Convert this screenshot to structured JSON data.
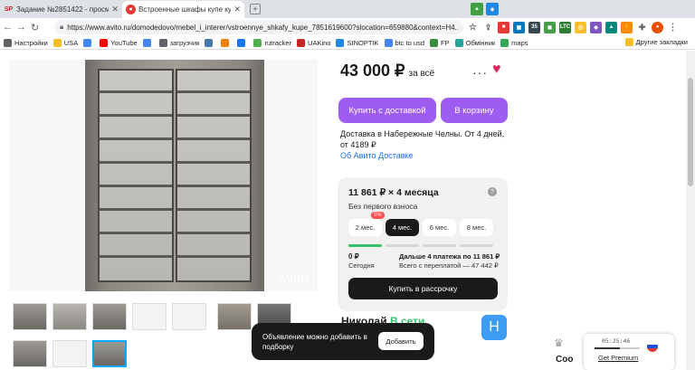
{
  "tabs": [
    {
      "favicon": "SP",
      "title": "Задание №2851422 - просмотр з"
    },
    {
      "favicon": "avito",
      "title": "Встроенные шкафы купе купить"
    }
  ],
  "omnibox": {
    "url": "https://www.avito.ru/domodedovo/mebel_i_interer/vstroennye_shkafy_kupe_7851619600?slocation=659880&context=H4..."
  },
  "bookmarks": [
    {
      "icon": "gear-icon",
      "label": "Настройки",
      "color": "#5f6368"
    },
    {
      "icon": "folder-icon",
      "label": "USA",
      "color": "#f6bf26"
    },
    {
      "icon": "google-icon",
      "label": "",
      "color": "#4285f4"
    },
    {
      "icon": "youtube-icon",
      "label": "YouTube",
      "color": "#ff0000"
    },
    {
      "icon": "g-icon",
      "label": "",
      "color": "#4285f4"
    },
    {
      "icon": "download-icon",
      "label": "загрузчик",
      "color": "#5f6368"
    },
    {
      "icon": "vk-icon",
      "label": "",
      "color": "#4a76a8"
    },
    {
      "icon": "ok-icon",
      "label": "",
      "color": "#ee8208"
    },
    {
      "icon": "f-icon",
      "label": "",
      "color": "#1877f2"
    },
    {
      "icon": "rutracker-icon",
      "label": "rutracker",
      "color": "#4caf50"
    },
    {
      "icon": "uakino-icon",
      "label": "UAKino",
      "color": "#c62828"
    },
    {
      "icon": "sinoptik-icon",
      "label": "SINOPTIK",
      "color": "#1e88e5"
    },
    {
      "icon": "google-icon",
      "label": "btc to usd",
      "color": "#4285f4"
    },
    {
      "icon": "fp-icon",
      "label": "FP",
      "color": "#388e3c"
    },
    {
      "icon": "exchange-icon",
      "label": "Обмінник",
      "color": "#26a69a"
    },
    {
      "icon": "maps-icon",
      "label": "maps",
      "color": "#34a853"
    }
  ],
  "bookmarks_right": "Другие закладки",
  "listing": {
    "price": "43 000 ₽",
    "price_suffix": "за всё",
    "more": "···",
    "buy_delivery": "Купить с доставкой",
    "add_to_cart": "В корзину",
    "delivery_text": "Доставка в Набережные Челны. От 4 дней, от 4189 ₽",
    "delivery_link": "Об Авито Доставке",
    "watermark": "Avito"
  },
  "installment": {
    "title": "11 861 ₽ × 4 месяца",
    "subtitle": "Без первого взноса",
    "help": "?",
    "badge": "0%",
    "options": [
      "2 мес.",
      "4 мес.",
      "6 мес.",
      "8 мес."
    ],
    "selected_option": "4 мес.",
    "progress_paid_segments": 1,
    "progress_total_segments": 4,
    "now_value": "0 ₽",
    "now_label": "Сегодня",
    "later_value": "Дальше 4 платежа по 11 861 ₽",
    "later_label": "Всего с переплатой — 47 442 ₽",
    "button": "Купить в рассрочку"
  },
  "seller": {
    "name": "Николай",
    "status": "В сети",
    "avatar_letter": "Н"
  },
  "toast": {
    "text": "Объявление можно добавить в подборку",
    "button": "Добавить"
  },
  "widget": {
    "time": "05:25:46",
    "link": "Get Premium",
    "progress": 0.55
  },
  "side_text": "Соо"
}
